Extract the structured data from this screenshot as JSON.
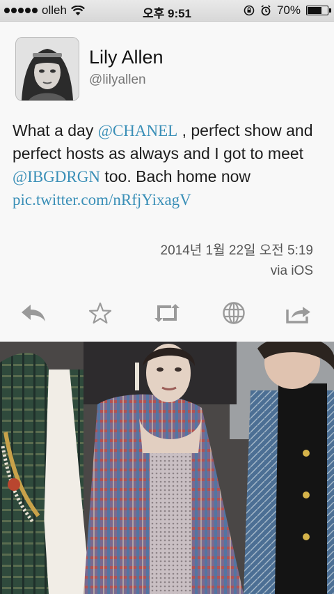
{
  "status_bar": {
    "carrier": "olleh",
    "time": "오후 9:51",
    "battery_text": "70%",
    "battery_level": 0.7
  },
  "tweet": {
    "author_name": "Lily Allen",
    "author_handle": "@lilyallen",
    "text_1": "What a day ",
    "mention_1": "@CHANEL",
    "text_2": " , perfect show and perfect hosts as always and I got to meet ",
    "mention_2": "@IBGDRGN",
    "text_3": " too. Bach home now",
    "link": "pic.twitter.com/nRfjYixagV",
    "timestamp": "2014년 1월 22일 오전 5:19",
    "via": "via iOS"
  },
  "actions": [
    {
      "icon": "reply-icon"
    },
    {
      "icon": "star-icon"
    },
    {
      "icon": "retweet-icon"
    },
    {
      "icon": "globe-icon"
    },
    {
      "icon": "share-icon"
    }
  ],
  "colors": {
    "mention": "#3a8fb7",
    "icon": "#9a9a9a"
  }
}
